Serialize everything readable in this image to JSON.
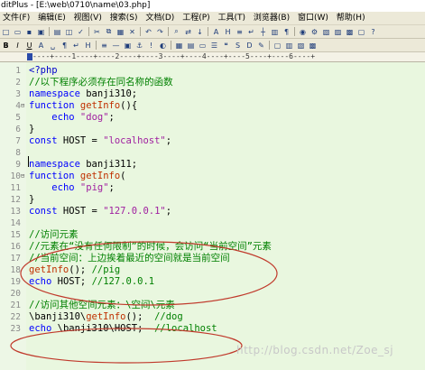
{
  "window": {
    "title": "ditPlus - [E:\\web\\0710\\name\\03.php]"
  },
  "menu": [
    "文件(F)",
    "编辑(E)",
    "视图(V)",
    "搜索(S)",
    "文档(D)",
    "工程(P)",
    "工具(T)",
    "浏览器(B)",
    "窗口(W)",
    "帮助(H)"
  ],
  "ruler": {
    "text": "----+----1----+----2----+----3----+----4----+----5----+----6----+"
  },
  "editor": {
    "lines": [
      {
        "n": "1",
        "fold": "",
        "tokens": [
          {
            "c": "php",
            "t": "<?php"
          }
        ]
      },
      {
        "n": "2",
        "fold": "",
        "tokens": [
          {
            "c": "comment",
            "t": "//以下程序必须存在同名称的函数"
          }
        ]
      },
      {
        "n": "3",
        "fold": "",
        "tokens": [
          {
            "c": "kw",
            "t": "namespace"
          },
          {
            "c": "plain",
            "t": " banji310;"
          }
        ]
      },
      {
        "n": "4",
        "fold": "⊟",
        "tokens": [
          {
            "c": "kw",
            "t": "function"
          },
          {
            "c": "plain",
            "t": " "
          },
          {
            "c": "func",
            "t": "getInfo"
          },
          {
            "c": "plain",
            "t": "(){"
          }
        ]
      },
      {
        "n": "5",
        "fold": "",
        "tokens": [
          {
            "c": "plain",
            "t": "    "
          },
          {
            "c": "kw",
            "t": "echo"
          },
          {
            "c": "plain",
            "t": " "
          },
          {
            "c": "str",
            "t": "\"dog\""
          },
          {
            "c": "plain",
            "t": ";"
          }
        ]
      },
      {
        "n": "6",
        "fold": "",
        "tokens": [
          {
            "c": "plain",
            "t": "}"
          }
        ]
      },
      {
        "n": "7",
        "fold": "",
        "tokens": [
          {
            "c": "kw",
            "t": "const"
          },
          {
            "c": "plain",
            "t": " HOST = "
          },
          {
            "c": "str",
            "t": "\"localhost\""
          },
          {
            "c": "plain",
            "t": ";"
          }
        ]
      },
      {
        "n": "8",
        "fold": "",
        "tokens": [
          {
            "c": "plain",
            "t": ""
          }
        ]
      },
      {
        "n": "9",
        "fold": "",
        "tokens": [
          {
            "c": "kw",
            "t": "namespace"
          },
          {
            "c": "plain",
            "t": " banji311;"
          }
        ]
      },
      {
        "n": "10",
        "fold": "⊟",
        "tokens": [
          {
            "c": "kw",
            "t": "function"
          },
          {
            "c": "plain",
            "t": " "
          },
          {
            "c": "func",
            "t": "getInfo"
          },
          {
            "c": "plain",
            "t": "("
          }
        ]
      },
      {
        "n": "11",
        "fold": "",
        "tokens": [
          {
            "c": "plain",
            "t": "    "
          },
          {
            "c": "kw",
            "t": "echo"
          },
          {
            "c": "plain",
            "t": " "
          },
          {
            "c": "str",
            "t": "\"pig\""
          },
          {
            "c": "plain",
            "t": ";"
          }
        ]
      },
      {
        "n": "12",
        "fold": "",
        "tokens": [
          {
            "c": "plain",
            "t": "}"
          }
        ]
      },
      {
        "n": "13",
        "fold": "",
        "tokens": [
          {
            "c": "kw",
            "t": "const"
          },
          {
            "c": "plain",
            "t": " HOST = "
          },
          {
            "c": "str",
            "t": "\"127.0.0.1\""
          },
          {
            "c": "plain",
            "t": ";"
          }
        ]
      },
      {
        "n": "14",
        "fold": "",
        "tokens": [
          {
            "c": "plain",
            "t": ""
          }
        ]
      },
      {
        "n": "15",
        "fold": "",
        "tokens": [
          {
            "c": "comment",
            "t": "//访问元素"
          }
        ]
      },
      {
        "n": "16",
        "fold": "",
        "tokens": [
          {
            "c": "comment",
            "t": "//元素在“没有任何限制”的时候，会访问“当前空间”元素"
          }
        ]
      },
      {
        "n": "17",
        "fold": "",
        "tokens": [
          {
            "c": "comment",
            "t": "//当前空间：上边挨着最近的空间就是当前空间"
          }
        ]
      },
      {
        "n": "18",
        "fold": "",
        "tokens": [
          {
            "c": "func",
            "t": "getInfo"
          },
          {
            "c": "plain",
            "t": "(); "
          },
          {
            "c": "comment",
            "t": "//pig"
          }
        ]
      },
      {
        "n": "19",
        "fold": "",
        "tokens": [
          {
            "c": "kw",
            "t": "echo"
          },
          {
            "c": "plain",
            "t": " HOST; "
          },
          {
            "c": "comment",
            "t": "//127.0.0.1"
          }
        ]
      },
      {
        "n": "20",
        "fold": "",
        "tokens": [
          {
            "c": "plain",
            "t": ""
          }
        ]
      },
      {
        "n": "21",
        "fold": "",
        "tokens": [
          {
            "c": "comment",
            "t": "//访问其他空间元素：\\空间\\元素"
          }
        ]
      },
      {
        "n": "22",
        "fold": "",
        "tokens": [
          {
            "c": "plain",
            "t": "\\banji310\\"
          },
          {
            "c": "func",
            "t": "getInfo"
          },
          {
            "c": "plain",
            "t": "();  "
          },
          {
            "c": "comment",
            "t": "//dog"
          }
        ]
      },
      {
        "n": "23",
        "fold": "",
        "tokens": [
          {
            "c": "kw",
            "t": "echo"
          },
          {
            "c": "plain",
            "t": " \\banji310\\HOST;  "
          },
          {
            "c": "comment",
            "t": "//localhost"
          }
        ]
      }
    ]
  },
  "watermark": "http://blog.csdn.net/Zoe_sj",
  "colors": {
    "editor_bg": "#e9f7df",
    "annotation_ellipse": "#c0392b"
  }
}
